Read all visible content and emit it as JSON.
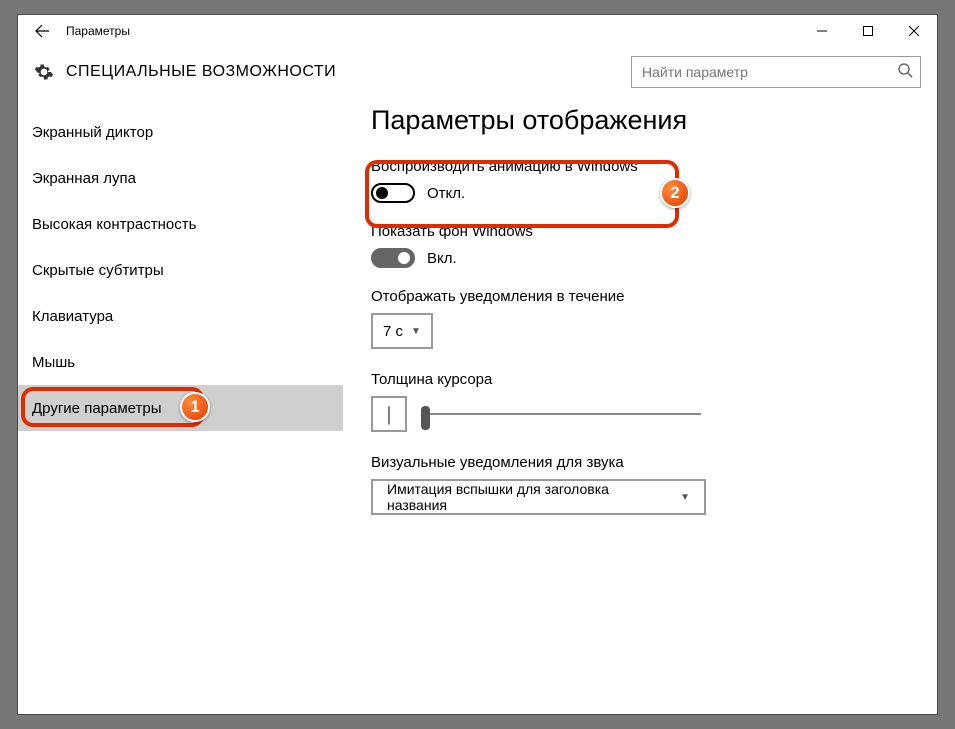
{
  "window_title": "Параметры",
  "page_title": "СПЕЦИАЛЬНЫЕ ВОЗМОЖНОСТИ",
  "search_placeholder": "Найти параметр",
  "sidebar": {
    "items": [
      {
        "label": "Экранный диктор"
      },
      {
        "label": "Экранная лупа"
      },
      {
        "label": "Высокая контрастность"
      },
      {
        "label": "Скрытые субтитры"
      },
      {
        "label": "Клавиатура"
      },
      {
        "label": "Мышь"
      },
      {
        "label": "Другие параметры"
      }
    ],
    "selected_index": 6
  },
  "content": {
    "heading": "Параметры отображения",
    "anim_label": "Воспроизводить анимацию в Windows",
    "anim_state": "Откл.",
    "bg_label": "Показать фон Windows",
    "bg_state": "Вкл.",
    "notif_label": "Отображать уведомления в течение",
    "notif_value": "7 с",
    "cursor_label": "Толщина курсора",
    "cursor_preview": "|",
    "visual_label": "Визуальные уведомления для звука",
    "visual_value": "Имитация вспышки для заголовка названия"
  },
  "badges": {
    "b1": "1",
    "b2": "2"
  }
}
